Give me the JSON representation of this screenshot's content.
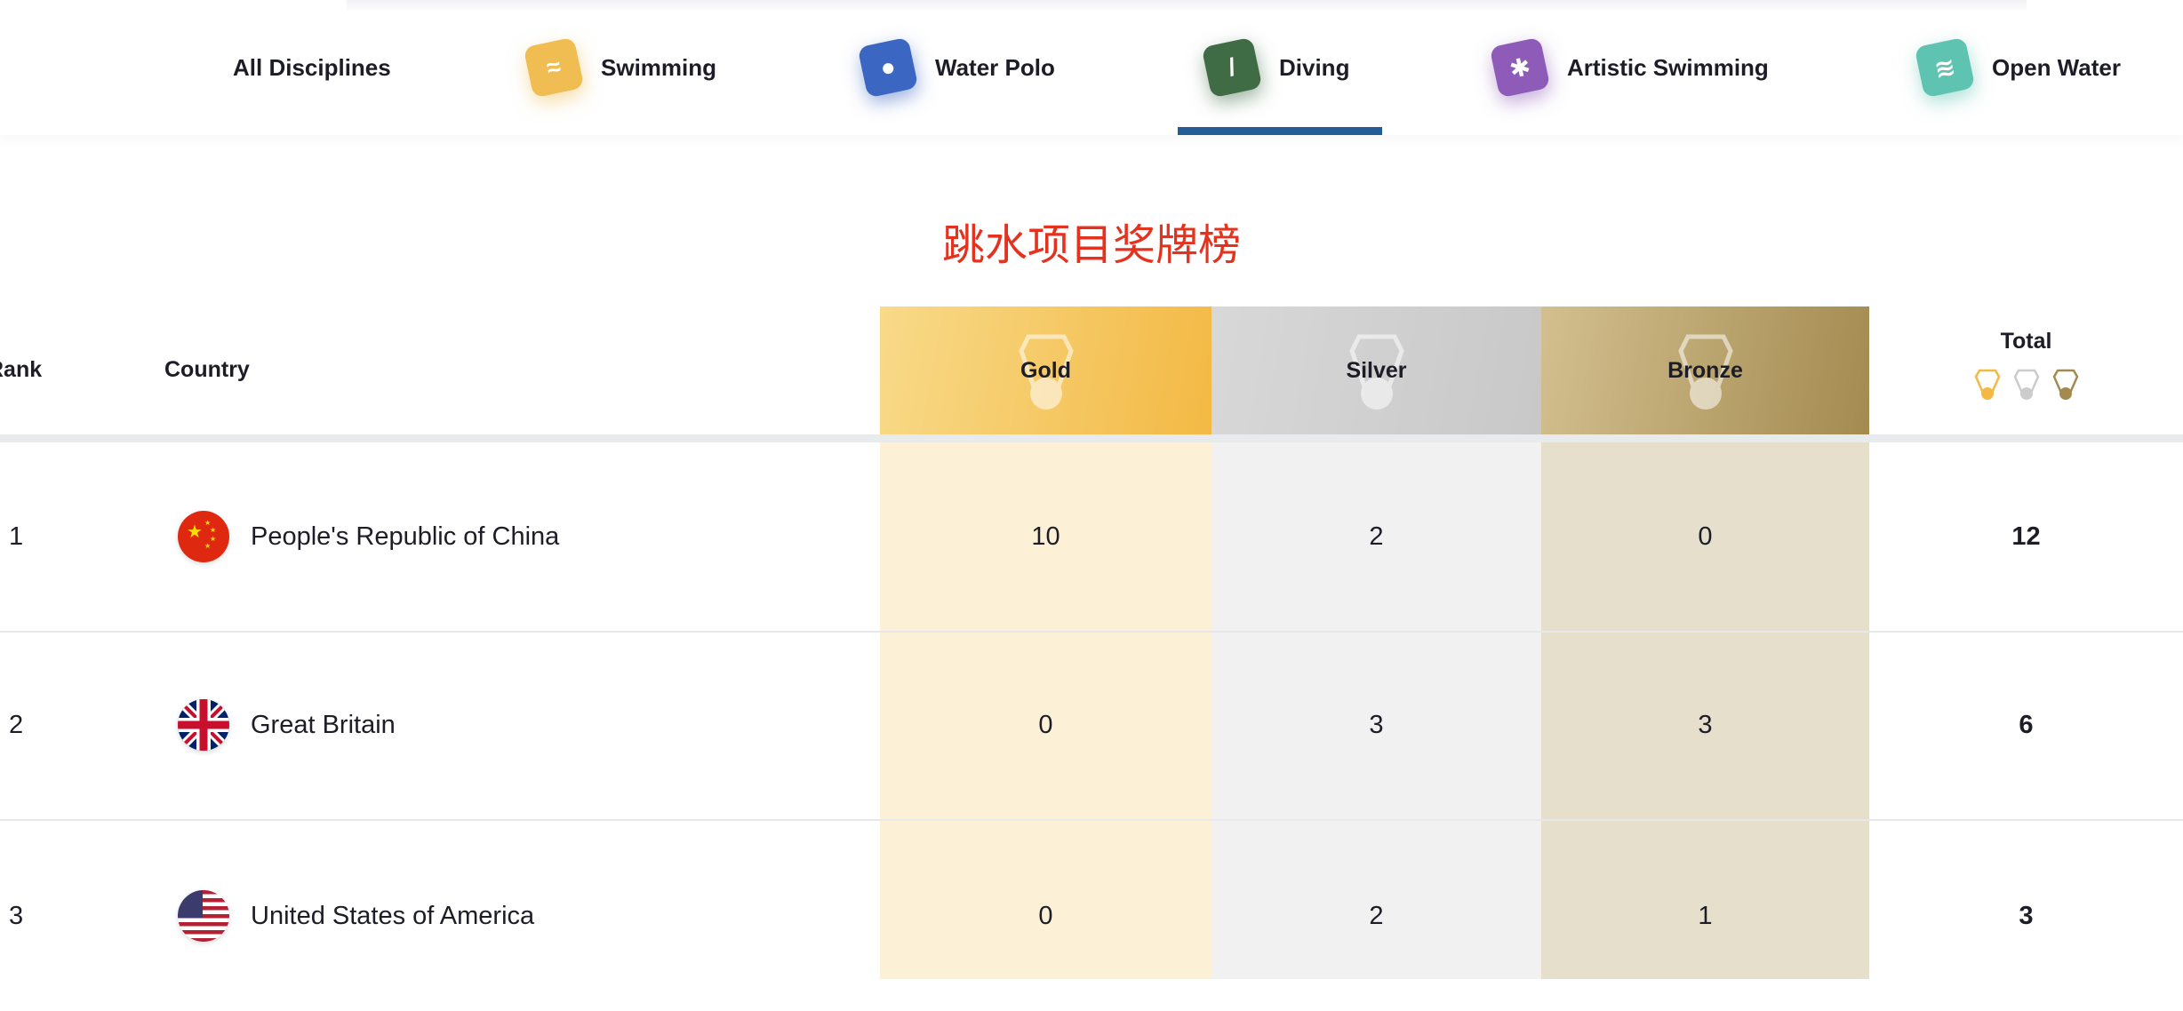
{
  "nav": {
    "items": [
      {
        "label": "All Disciplines",
        "icon": null
      },
      {
        "label": "Swimming",
        "icon": "swimming-icon",
        "color": "#f0bd52"
      },
      {
        "label": "Water Polo",
        "icon": "water-polo-icon",
        "color": "#3b66c2"
      },
      {
        "label": "Diving",
        "icon": "diving-icon",
        "color": "#3f6b45"
      },
      {
        "label": "Artistic Swimming",
        "icon": "artistic-swimming-icon",
        "color": "#8e5cb8"
      },
      {
        "label": "Open Water",
        "icon": "open-water-icon",
        "color": "#5fc3b2"
      }
    ],
    "active": "Diving",
    "accent": "#245d95"
  },
  "title": "跳水项目奖牌榜",
  "table": {
    "headers": {
      "rank": "Rank",
      "country": "Country",
      "gold": "Gold",
      "silver": "Silver",
      "bronze": "Bronze",
      "total": "Total"
    },
    "rows": [
      {
        "rank": "1",
        "country": "People's Republic of China",
        "flag": "china",
        "gold": "10",
        "silver": "2",
        "bronze": "0",
        "total": "12"
      },
      {
        "rank": "2",
        "country": "Great Britain",
        "flag": "great-britain",
        "gold": "0",
        "silver": "3",
        "bronze": "3",
        "total": "6"
      },
      {
        "rank": "3",
        "country": "United States of America",
        "flag": "usa",
        "gold": "0",
        "silver": "2",
        "bronze": "1",
        "total": "3"
      }
    ]
  },
  "colors": {
    "gold": "#f3b944",
    "silver": "#c8c8c8",
    "bronze": "#a38b50",
    "title": "#e4321f"
  }
}
